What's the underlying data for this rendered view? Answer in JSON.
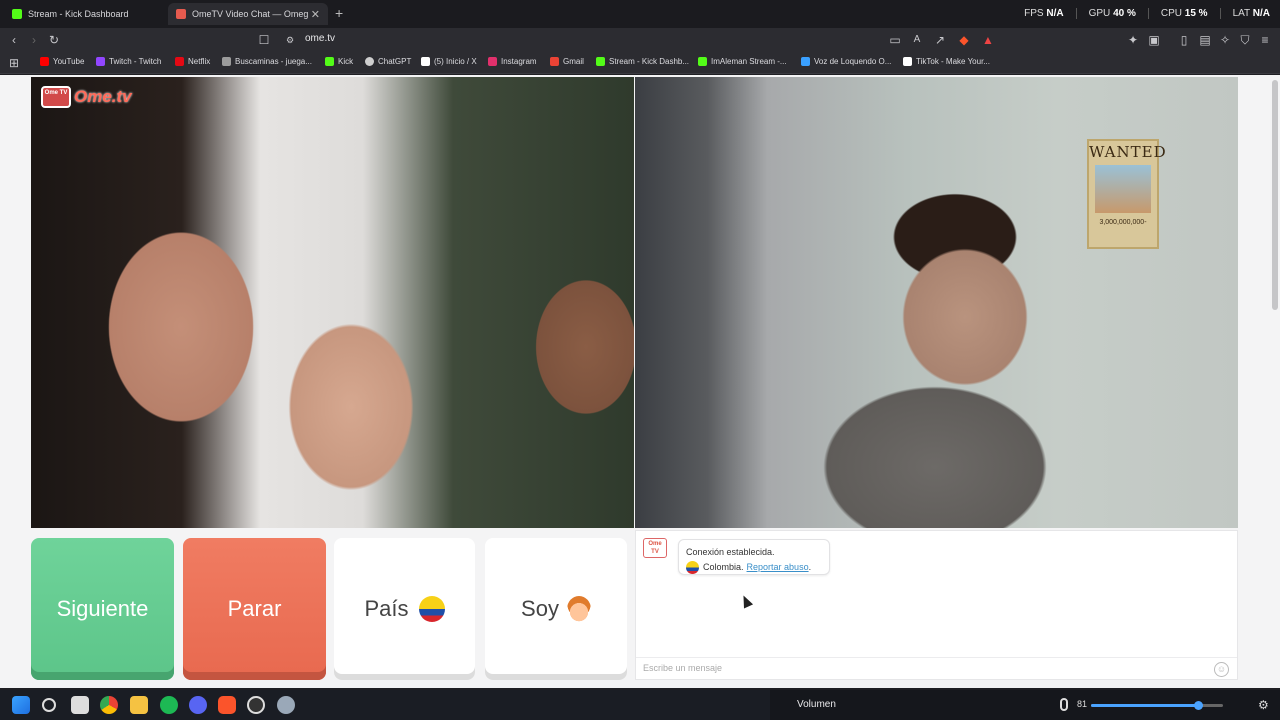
{
  "tabs": [
    {
      "title": "Stream - Kick Dashboard",
      "active": false,
      "color": "#53fc18"
    },
    {
      "title": "OmeTV Video Chat — Omeg",
      "active": true,
      "color": "#e65b4f"
    }
  ],
  "stats": {
    "fps_label": "FPS",
    "fps_value": "N/A",
    "gpu_label": "GPU",
    "gpu_value": "40 %",
    "cpu_label": "CPU",
    "cpu_value": "15 %",
    "lat_label": "LAT",
    "lat_value": "N/A"
  },
  "toolbar": {
    "url": "ome.tv"
  },
  "bookmarks": [
    {
      "label": "YouTube",
      "color": "#ff0000"
    },
    {
      "label": "Twitch - Twitch",
      "color": "#9146ff"
    },
    {
      "label": "Netflix",
      "color": "#e50914"
    },
    {
      "label": "Buscaminas - juega...",
      "color": "#9c9c9c"
    },
    {
      "label": "Kick",
      "color": "#53fc18"
    },
    {
      "label": "ChatGPT",
      "color": "#cfcfcf"
    },
    {
      "label": "(5) Inicio / X",
      "color": "#ffffff"
    },
    {
      "label": "Instagram",
      "color": "#e1306c"
    },
    {
      "label": "Gmail",
      "color": "#ea4335"
    },
    {
      "label": "Stream - Kick Dashb...",
      "color": "#53fc18"
    },
    {
      "label": "ImAleman Stream -...",
      "color": "#53fc18"
    },
    {
      "label": "Voz de Loquendo O...",
      "color": "#3aa0ff"
    },
    {
      "label": "TikTok - Make Your...",
      "color": "#ffffff"
    }
  ],
  "logo": {
    "tv": "Ome TV",
    "text": "Ome.tv"
  },
  "poster": {
    "title": "WANTED",
    "bounty": "3,000,000,000-"
  },
  "buttons": {
    "next": "Siguiente",
    "stop": "Parar",
    "country": "País",
    "gender": "Soy"
  },
  "chat": {
    "logo": "Ome TV",
    "connected": "Conexión establecida.",
    "country": "Colombia.",
    "report": "Reportar abuso",
    "report_suffix": ".",
    "placeholder": "Escribe un mensaje"
  },
  "taskbar": {
    "volume_label": "Volumen",
    "volume_value": "81",
    "volume_level": 0.81,
    "icons": [
      "windows-start",
      "search",
      "store",
      "chrome",
      "file-explorer",
      "spotify",
      "discord",
      "brave",
      "obs",
      "settings"
    ]
  }
}
